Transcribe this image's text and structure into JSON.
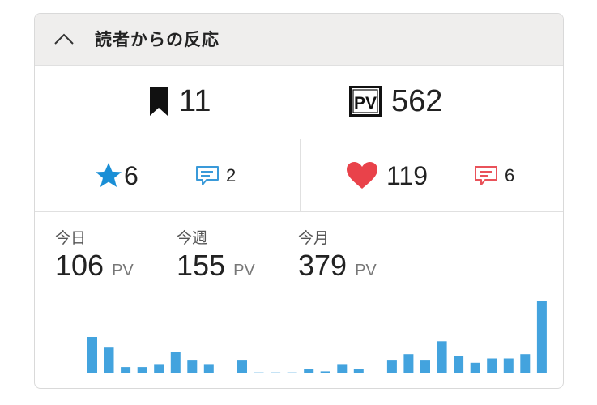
{
  "widget": {
    "title": "読者からの反応",
    "collapse_icon": "chevron-up-icon"
  },
  "totals": {
    "bookmarks": "11",
    "pageviews": "562",
    "pv_badge": "PV"
  },
  "hatena": {
    "stars": "6",
    "comments": "2",
    "star_color": "#1a8fd6",
    "comment_color": "#3a9ad9"
  },
  "other": {
    "likes": "119",
    "comments": "6",
    "heart_color": "#e9424a",
    "comment_color": "#e9525a"
  },
  "pv_stats": [
    {
      "label": "今日",
      "value": "106",
      "unit": "PV"
    },
    {
      "label": "今週",
      "value": "155",
      "unit": "PV"
    },
    {
      "label": "今月",
      "value": "379",
      "unit": "PV"
    }
  ],
  "chart_data": {
    "type": "bar",
    "bar_color": "#43a3de",
    "values": [
      17,
      12,
      3,
      3,
      4,
      10,
      6,
      4,
      0,
      6,
      0.5,
      0.5,
      0.5,
      2,
      1,
      4,
      2,
      0,
      6,
      9,
      6,
      15,
      8,
      5,
      7,
      7,
      9,
      34
    ]
  }
}
